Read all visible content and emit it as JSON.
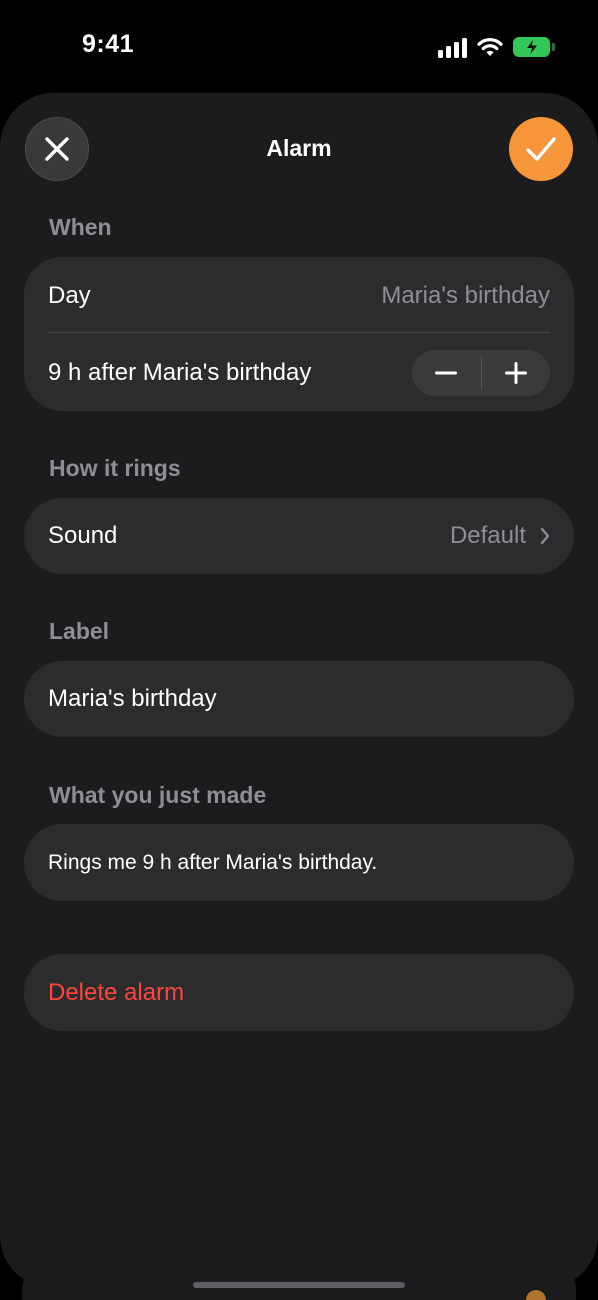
{
  "status_bar": {
    "time": "9:41",
    "signal_icon": "cellular-signal-icon",
    "wifi_icon": "wifi-icon",
    "battery_icon": "battery-charging-icon",
    "battery_color": "#33c759"
  },
  "header": {
    "title": "Alarm",
    "close_icon": "close-icon",
    "confirm_icon": "checkmark-icon",
    "accent_color": "#f7953a"
  },
  "when": {
    "header": "When",
    "day_label": "Day",
    "day_value": "Maria's birthday",
    "offset_label": "9 h after Maria's birthday",
    "decrement_icon": "minus-icon",
    "increment_icon": "plus-icon"
  },
  "rings": {
    "header": "How it rings",
    "sound_label": "Sound",
    "sound_value": "Default",
    "chevron_icon": "chevron-right-icon"
  },
  "label": {
    "header": "Label",
    "value": "Maria's birthday"
  },
  "summary": {
    "header": "What you just made",
    "text": "Rings me 9 h after Maria's birthday."
  },
  "delete": {
    "label": "Delete alarm",
    "color": "#ff453a"
  }
}
